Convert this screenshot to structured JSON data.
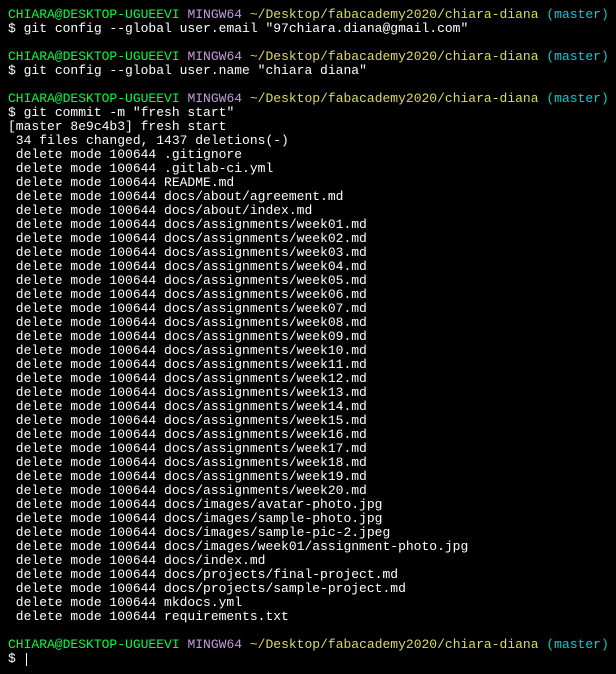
{
  "prompt": {
    "user": "CHIARA@DESKTOP-UGUEEVI",
    "sys": " MINGW64",
    "sep": " ",
    "path": "~/Desktop/fabacademy2020/chiara-diana",
    "branchOpen": " (",
    "branch": "master",
    "branchClose": ")"
  },
  "dollar": "$ ",
  "cmd1": "git config --global user.email \"97chiara.diana@gmail.com\"",
  "cmd2": "git config --global user.name \"chiara diana\"",
  "cmd3": "git commit -m \"fresh start\"",
  "commitLine": "[master 8e9c4b3] fresh start",
  "summaryLine": " 34 files changed, 1437 deletions(-)",
  "deletePrefix": " delete mode 100644 ",
  "deleteFiles": [
    ".gitignore",
    ".gitlab-ci.yml",
    "README.md",
    "docs/about/agreement.md",
    "docs/about/index.md",
    "docs/assignments/week01.md",
    "docs/assignments/week02.md",
    "docs/assignments/week03.md",
    "docs/assignments/week04.md",
    "docs/assignments/week05.md",
    "docs/assignments/week06.md",
    "docs/assignments/week07.md",
    "docs/assignments/week08.md",
    "docs/assignments/week09.md",
    "docs/assignments/week10.md",
    "docs/assignments/week11.md",
    "docs/assignments/week12.md",
    "docs/assignments/week13.md",
    "docs/assignments/week14.md",
    "docs/assignments/week15.md",
    "docs/assignments/week16.md",
    "docs/assignments/week17.md",
    "docs/assignments/week18.md",
    "docs/assignments/week19.md",
    "docs/assignments/week20.md",
    "docs/images/avatar-photo.jpg",
    "docs/images/sample-photo.jpg",
    "docs/images/sample-pic-2.jpeg",
    "docs/images/week01/assignment-photo.jpg",
    "docs/index.md",
    "docs/projects/final-project.md",
    "docs/projects/sample-project.md",
    "mkdocs.yml",
    "requirements.txt"
  ]
}
